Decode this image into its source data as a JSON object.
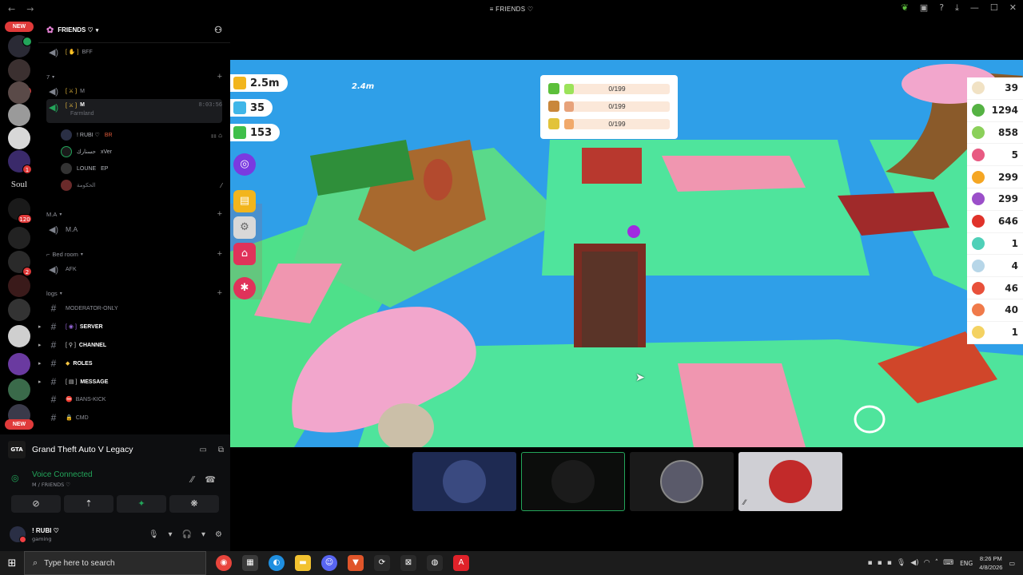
{
  "window": {
    "title": "FRIENDS ♡"
  },
  "rail": {
    "new_top": "NEW",
    "new_bottom": "NEW",
    "soul_label": "Soul",
    "badge_values": [
      "1",
      "1",
      "1",
      "120",
      "2"
    ]
  },
  "server": {
    "name": "FRIENDS ♡"
  },
  "channels": {
    "bff": "BFF",
    "cat_7": "7",
    "m1": "M",
    "m2_active": "M",
    "m2_timer": "8:03:56",
    "m2_activity": "Farmland",
    "voice_users": [
      {
        "name": "! RUBI ♡",
        "tag": "BR"
      },
      {
        "name": "حسنارك",
        "tag": "xVer"
      },
      {
        "name": "LOUNE",
        "tag": "EP"
      },
      {
        "name": "الحكومة",
        "tag": ""
      }
    ],
    "cat_ma": "M.A",
    "ma": "M.A",
    "cat_bedroom": "Bed room",
    "afk": "AFK",
    "cat_logs": "logs",
    "moderator": "MODERATOR-ONLY",
    "server_ch": "SERVER",
    "channel_ch": "CHANNEL",
    "roles": "ROLES",
    "message": "MESSAGE",
    "bans": "BANS-KICK",
    "cmd": "CMD"
  },
  "activity": {
    "game": "Grand Theft Auto V Legacy"
  },
  "voice": {
    "status": "Voice Connected",
    "location": "M / FRIENDS ♡"
  },
  "user": {
    "name": "! RUBI ♡",
    "status": "gaming"
  },
  "game": {
    "distance": "2.4m",
    "resources": [
      {
        "value": "2.5m",
        "color": "#f2b51c"
      },
      {
        "value": "35",
        "color": "#3fb6e8"
      },
      {
        "value": "153",
        "color": "#3fbf4a"
      }
    ],
    "quests": [
      {
        "value": "0/199",
        "color": "#5cbf3a",
        "fill": "#9be35a"
      },
      {
        "value": "0/199",
        "color": "#c9873b",
        "fill": "#e7a27a"
      },
      {
        "value": "0/199",
        "color": "#e2c33a",
        "fill": "#f1a96a"
      }
    ],
    "inventory": [
      {
        "value": "39",
        "color": "#f1e2c4"
      },
      {
        "value": "1294",
        "color": "#55b243"
      },
      {
        "value": "858",
        "color": "#8bd05a"
      },
      {
        "value": "5",
        "color": "#e85a82"
      },
      {
        "value": "299",
        "color": "#f5a623"
      },
      {
        "value": "299",
        "color": "#9b4fc9"
      },
      {
        "value": "646",
        "color": "#e0322a"
      },
      {
        "value": "1",
        "color": "#4fd0b8"
      },
      {
        "value": "4",
        "color": "#b7d6e8"
      },
      {
        "value": "46",
        "color": "#e8503a"
      },
      {
        "value": "40",
        "color": "#f07a4a"
      },
      {
        "value": "1",
        "color": "#f4d262"
      }
    ]
  },
  "taskbar": {
    "search_placeholder": "Type here to search",
    "lang": "ENG",
    "time": "8:26 PM",
    "date": "4/8/2026"
  }
}
